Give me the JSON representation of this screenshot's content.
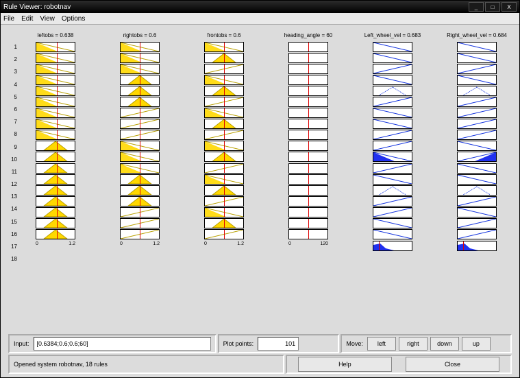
{
  "window": {
    "title": "Rule Viewer: robotnav",
    "min": "_",
    "max": "□",
    "close": "X"
  },
  "menu": {
    "file": "File",
    "edit": "Edit",
    "view": "View",
    "options": "Options"
  },
  "headers": {
    "col1": "leftobs = 0.638",
    "col2": "rightobs = 0.6",
    "col3": "frontobs = 0.6",
    "col4": "heading_angle = 60",
    "col5": "Left_wheel_vel = 0.683",
    "col6": "Right_wheel_vel = 0.684"
  },
  "scales": {
    "in_min": "0",
    "in_max": "1.2",
    "ang_min": "0",
    "ang_max": "120"
  },
  "inputs": {
    "label": "Input:",
    "value": "[0.6384;0.6;0.6;60]",
    "plot_label": "Plot points:",
    "plot_value": "101",
    "move_label": "Move:",
    "left": "left",
    "right": "right",
    "down": "down",
    "up": "up"
  },
  "status": {
    "text": "Opened system robotnav, 18 rules"
  },
  "buttons": {
    "help": "Help",
    "close": "Close"
  },
  "rules": {
    "count": 18,
    "redline_inputs": [
      0.53,
      0.5,
      0.5,
      0.5
    ],
    "cells": [
      [
        {
          "t": "decY"
        },
        {
          "t": "decY"
        },
        {
          "t": "decY"
        },
        {
          "t": "empty"
        },
        {
          "t": "odec"
        },
        {
          "t": "odec"
        }
      ],
      [
        {
          "t": "decY"
        },
        {
          "t": "decY"
        },
        {
          "t": "triY",
          "p": 0.5
        },
        {
          "t": "empty"
        },
        {
          "t": "odec"
        },
        {
          "t": "odec"
        }
      ],
      [
        {
          "t": "decY"
        },
        {
          "t": "decY"
        },
        {
          "t": "incL"
        },
        {
          "t": "empty"
        },
        {
          "t": "oinc"
        },
        {
          "t": "oinc"
        }
      ],
      [
        {
          "t": "decY"
        },
        {
          "t": "triY",
          "p": 0.5
        },
        {
          "t": "decY"
        },
        {
          "t": "empty"
        },
        {
          "t": "odec"
        },
        {
          "t": "odec"
        }
      ],
      [
        {
          "t": "decY"
        },
        {
          "t": "triY",
          "p": 0.5
        },
        {
          "t": "triY",
          "p": 0.5
        },
        {
          "t": "empty"
        },
        {
          "t": "otriD",
          "p": 0.5
        },
        {
          "t": "otriD",
          "p": 0.5
        }
      ],
      [
        {
          "t": "decY"
        },
        {
          "t": "triY",
          "p": 0.5
        },
        {
          "t": "incL"
        },
        {
          "t": "empty"
        },
        {
          "t": "oinc"
        },
        {
          "t": "oinc"
        }
      ],
      [
        {
          "t": "decY"
        },
        {
          "t": "incL"
        },
        {
          "t": "decY"
        },
        {
          "t": "empty"
        },
        {
          "t": "odec"
        },
        {
          "t": "oinc"
        }
      ],
      [
        {
          "t": "decY"
        },
        {
          "t": "incL"
        },
        {
          "t": "triY",
          "p": 0.5
        },
        {
          "t": "empty"
        },
        {
          "t": "odec"
        },
        {
          "t": "oinc"
        }
      ],
      [
        {
          "t": "decY"
        },
        {
          "t": "incL"
        },
        {
          "t": "incL"
        },
        {
          "t": "empty"
        },
        {
          "t": "oinc"
        },
        {
          "t": "oinc"
        }
      ],
      [
        {
          "t": "triY",
          "p": 0.5
        },
        {
          "t": "decY"
        },
        {
          "t": "decY"
        },
        {
          "t": "empty"
        },
        {
          "t": "oinc"
        },
        {
          "t": "odec"
        }
      ],
      [
        {
          "t": "triY",
          "p": 0.5
        },
        {
          "t": "decY"
        },
        {
          "t": "triY",
          "p": 0.5
        },
        {
          "t": "empty"
        },
        {
          "t": "ofill",
          "p": 0.0
        },
        {
          "t": "ofill",
          "p": 1.0
        }
      ],
      [
        {
          "t": "triY",
          "p": 0.5
        },
        {
          "t": "decY"
        },
        {
          "t": "incL"
        },
        {
          "t": "empty"
        },
        {
          "t": "oinc"
        },
        {
          "t": "odec"
        }
      ],
      [
        {
          "t": "triY",
          "p": 0.5
        },
        {
          "t": "triY",
          "p": 0.5
        },
        {
          "t": "decY"
        },
        {
          "t": "empty"
        },
        {
          "t": "odec"
        },
        {
          "t": "odec"
        }
      ],
      [
        {
          "t": "triY",
          "p": 0.5
        },
        {
          "t": "triY",
          "p": 0.5
        },
        {
          "t": "triY",
          "p": 0.5
        },
        {
          "t": "empty"
        },
        {
          "t": "otriD",
          "p": 0.5
        },
        {
          "t": "otriD",
          "p": 0.5
        }
      ],
      [
        {
          "t": "triY",
          "p": 0.5
        },
        {
          "t": "triY",
          "p": 0.5
        },
        {
          "t": "incL"
        },
        {
          "t": "empty"
        },
        {
          "t": "oinc"
        },
        {
          "t": "oinc"
        }
      ],
      [
        {
          "t": "triY",
          "p": 0.5
        },
        {
          "t": "incL"
        },
        {
          "t": "decY"
        },
        {
          "t": "empty"
        },
        {
          "t": "oinc"
        },
        {
          "t": "odec"
        }
      ],
      [
        {
          "t": "triY",
          "p": 0.5
        },
        {
          "t": "incL"
        },
        {
          "t": "triY",
          "p": 0.5
        },
        {
          "t": "empty"
        },
        {
          "t": "odec"
        },
        {
          "t": "oinc"
        }
      ],
      [
        {
          "t": "triY",
          "p": 0.5
        },
        {
          "t": "incL"
        },
        {
          "t": "incL"
        },
        {
          "t": "empty"
        },
        {
          "t": "odec"
        },
        {
          "t": "oinc"
        }
      ]
    ]
  }
}
